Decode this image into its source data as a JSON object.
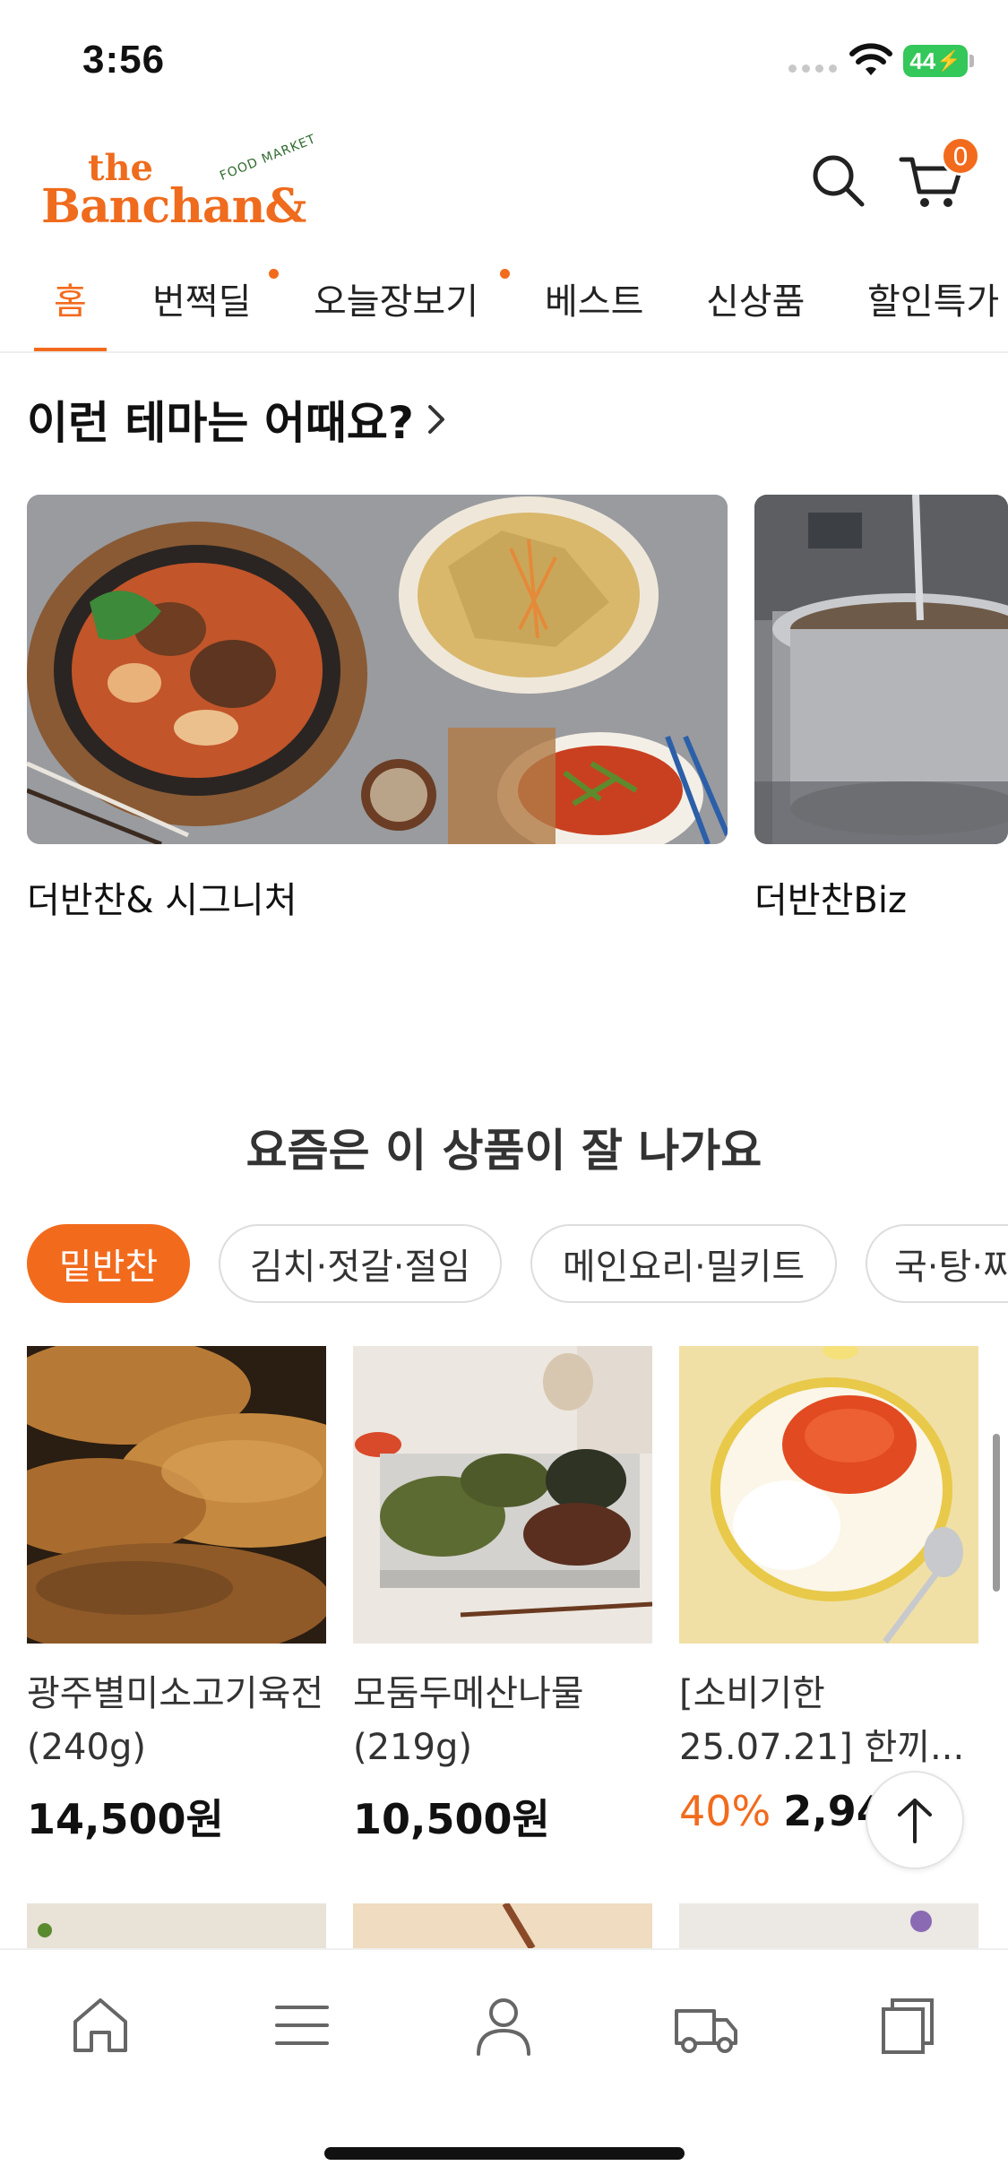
{
  "status_bar": {
    "time": "3:56",
    "battery": "44"
  },
  "header": {
    "logo": {
      "the": "the",
      "banchan": "Banchan&",
      "food_market": "FOOD MARKET"
    },
    "cart_count": "0"
  },
  "nav": {
    "tabs": [
      {
        "label": "홈",
        "active": true,
        "dot": false
      },
      {
        "label": "번쩍딜",
        "active": false,
        "dot": true
      },
      {
        "label": "오늘장보기",
        "active": false,
        "dot": true
      },
      {
        "label": "베스트",
        "active": false,
        "dot": false
      },
      {
        "label": "신상품",
        "active": false,
        "dot": false
      },
      {
        "label": "할인특가",
        "active": false,
        "dot": false
      }
    ]
  },
  "theme": {
    "title": "이런 테마는 어때요?",
    "cards": [
      {
        "label": "더반찬& 시그니처"
      },
      {
        "label": "더반찬Biz"
      }
    ]
  },
  "best": {
    "title": "요즘은 이 상품이 잘 나가요",
    "chips": [
      {
        "label": "밑반찬",
        "active": true
      },
      {
        "label": "김치·젓갈·절임",
        "active": false
      },
      {
        "label": "메인요리·밀키트",
        "active": false
      },
      {
        "label": "국·탕·찌개",
        "active": false
      }
    ],
    "products": [
      {
        "name": "광주별미소고기육전(240g)",
        "discount": "",
        "price": "14,500원"
      },
      {
        "name": "모둠두메산나물(219g)",
        "discount": "",
        "price": "10,500원"
      },
      {
        "name": "[소비기한 25.07.21] 한끼...",
        "discount": "40%",
        "price": "2,94"
      }
    ]
  },
  "colors": {
    "accent": "#f26b1d",
    "logo": "#ef6b1d",
    "logo_green": "#2f6b2f"
  },
  "bottom_nav": {
    "icons": [
      "home-icon",
      "menu-icon",
      "user-icon",
      "delivery-truck-icon",
      "recent-items-icon"
    ]
  }
}
